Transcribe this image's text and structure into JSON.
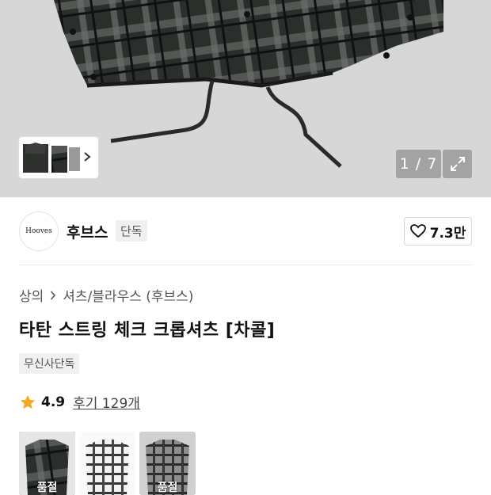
{
  "gallery": {
    "counter": "1 / 7",
    "thumb_next_icon": "chevron-right-icon",
    "zoom_icon": "expand-icon"
  },
  "brand": {
    "logo_text": "Hooves",
    "name": "후브스",
    "badge": "단독",
    "likes": "7.3만",
    "like_icon": "heart-outline-icon"
  },
  "breadcrumb": {
    "items": [
      "상의",
      "셔츠/블라우스 (후브스)"
    ],
    "separator_icon": "chevron-right-icon"
  },
  "product": {
    "title": "타탄 스트링 체크 크롭셔츠 [차콜]",
    "tag": "무신사단독"
  },
  "rating": {
    "score": "4.9",
    "review_text": "후기 129개",
    "star_color": "#f5a623"
  },
  "swatches": [
    {
      "label": "품절",
      "color": "charcoal",
      "selected": true
    },
    {
      "label": "",
      "color": "white",
      "selected": false
    },
    {
      "label": "품절",
      "color": "gray",
      "selected": false
    }
  ]
}
